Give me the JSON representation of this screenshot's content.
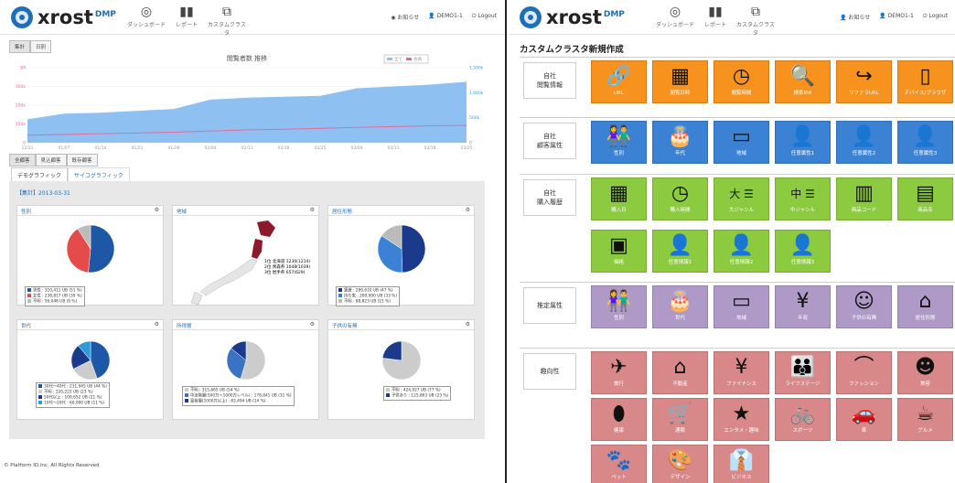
{
  "brand": {
    "name": "xrost",
    "suffix": "DMP"
  },
  "left": {
    "nav": [
      {
        "label": "ダッシュボード",
        "icon": "dashboard-icon",
        "glyph": "◎"
      },
      {
        "label": "レポート",
        "icon": "report-icon",
        "glyph": "▮▮"
      },
      {
        "label": "カスタムクラスタ",
        "icon": "cluster-icon",
        "glyph": "⧉"
      }
    ],
    "util": {
      "notice": "お知らせ",
      "user": "DEMO1-1",
      "logout": "Logout"
    },
    "toggle": [
      "集計",
      "日別"
    ],
    "chart_data": {
      "type": "area",
      "title": "閲覧者数 推移",
      "legend": [
        "全て",
        "会員"
      ],
      "x": [
        "12/31",
        "01/07",
        "01/14",
        "01/21",
        "01/28",
        "02/04",
        "02/11",
        "02/18",
        "02/25",
        "03/04",
        "03/11",
        "03/18",
        "03/25"
      ],
      "ylabels_left": [
        "3M",
        "300k",
        "200k",
        "150k",
        "0"
      ],
      "ylabels_right": [
        "1,500k",
        "1,000k",
        "500k",
        "0"
      ],
      "series": [
        {
          "name": "全て",
          "values": [
            125000,
            155000,
            160000,
            170000,
            180000,
            230000,
            240000,
            245000,
            250000,
            290000,
            300000,
            310000,
            325000
          ]
        },
        {
          "name": "会員",
          "values": [
            40000,
            44000,
            48000,
            52000,
            56000,
            62000,
            68000,
            72000,
            76000,
            82000,
            86000,
            90000,
            92000
          ]
        }
      ]
    },
    "visitor_tabs": [
      "全顧客",
      "見込顧客",
      "既存顧客"
    ],
    "profile_tabs": [
      "デモグラフィック",
      "サイコグラフィック"
    ],
    "aggregate": "【集計】2013-03-31",
    "cards": [
      {
        "title": "性別",
        "legend": [
          {
            "color": "#1e57a6",
            "text": "男性 : 310,411 UB (51 %)"
          },
          {
            "color": "#e64b4b",
            "text": "女性 : 238,817 UB (39 %)"
          },
          {
            "color": "#bbbbbb",
            "text": "不明 : 56,048 UB (9 %)"
          }
        ],
        "slices": [
          51,
          39,
          9
        ]
      },
      {
        "title": "地域",
        "ranks": [
          "1位 北海道 1230(1214)",
          "2位 青森県 1048(1039)",
          "3位 岩手県 657(629)"
        ]
      },
      {
        "title": "居住形態",
        "legend": [
          {
            "color": "#1c3a8c",
            "text": "賃貸 : 289,610 UB (47 %)"
          },
          {
            "color": "#3b82d4",
            "text": "持ち家 : 200,990 UB (33 %)"
          },
          {
            "color": "#bbbbbb",
            "text": "不明 : 88,823 UB (15 %)"
          }
        ],
        "slices": [
          47,
          33,
          15
        ]
      },
      {
        "title": "世代",
        "legend": [
          {
            "color": "#1e57a6",
            "text": "30代〜40代 : 231,945 UB (44 %)"
          },
          {
            "color": "#cccccc",
            "text": "不明 : 120,223 UB (23 %)"
          },
          {
            "color": "#1c3a8c",
            "text": "50代以上 : 109,652 UB (21 %)"
          },
          {
            "color": "#2e9bd4",
            "text": "10代〜20代 : 60,000 UB (11 %)"
          }
        ],
        "slices": [
          44,
          23,
          21,
          11
        ]
      },
      {
        "title": "所得層",
        "legend": [
          {
            "color": "#cccccc",
            "text": "不明 : 315,665 UB (54 %)"
          },
          {
            "color": "#3b72c4",
            "text": "中流階層(500万〜1000万レベル) : 178,841 UB (31 %)"
          },
          {
            "color": "#1c3a8c",
            "text": "富裕層(1000万以上) : 83,494 UB (14 %)"
          }
        ],
        "slices": [
          54,
          31,
          14
        ]
      },
      {
        "title": "子供の有無",
        "legend": [
          {
            "color": "#cccccc",
            "text": "不明 : 424,927 UB (77 %)"
          },
          {
            "color": "#1c3a8c",
            "text": "子供あり : 125,863 UB (23 %)"
          }
        ],
        "slices": [
          77,
          23
        ]
      }
    ],
    "copyright": "© Platform ID,inc. All Rights Reserved"
  },
  "right": {
    "title": "カスタムクラスタ新規作成",
    "groups": [
      {
        "label": "自社\n閲覧情報",
        "color": "or",
        "tiles": [
          {
            "label": "URL",
            "icon": "url-icon",
            "glyph": "🔗"
          },
          {
            "label": "閲覧日時",
            "icon": "calendar-icon",
            "glyph": "▦"
          },
          {
            "label": "閲覧時間",
            "icon": "clock-icon",
            "glyph": "◷"
          },
          {
            "label": "検索KW",
            "icon": "search-keyword-icon",
            "glyph": "🔍"
          },
          {
            "label": "リファラURL",
            "icon": "referrer-icon",
            "glyph": "↪"
          },
          {
            "label": "デバイス/ブラウザ",
            "icon": "device-icon",
            "glyph": "▯"
          }
        ]
      },
      {
        "label": "自社\n顧客属性",
        "color": "bl",
        "tiles": [
          {
            "label": "性別",
            "icon": "gender-icon",
            "glyph": "👫"
          },
          {
            "label": "年代",
            "icon": "age-cake-icon",
            "glyph": "🎂"
          },
          {
            "label": "地域",
            "icon": "region-icon",
            "glyph": "▭"
          },
          {
            "label": "任意属性1",
            "icon": "add-user-icon",
            "glyph": "👤"
          },
          {
            "label": "任意属性2",
            "icon": "add-user-icon",
            "glyph": "👤"
          },
          {
            "label": "任意属性3",
            "icon": "add-user-icon",
            "glyph": "👤"
          }
        ]
      },
      {
        "label": "自社\n購入履歴",
        "color": "gr",
        "tiles": [
          {
            "label": "購入日",
            "icon": "calendar-icon",
            "glyph": "▦"
          },
          {
            "label": "購入時間",
            "icon": "clock-icon",
            "glyph": "◷"
          },
          {
            "label": "大ジャンル",
            "icon": "large-genre-icon",
            "glyph": "大 ☰"
          },
          {
            "label": "中ジャンル",
            "icon": "middle-genre-icon",
            "glyph": "中 ☰"
          },
          {
            "label": "商品コード",
            "icon": "barcode-icon",
            "glyph": "▥"
          },
          {
            "label": "商品名",
            "icon": "product-name-icon",
            "glyph": "▤"
          },
          {
            "label": "価格",
            "icon": "register-icon",
            "glyph": "▣"
          },
          {
            "label": "任意情報1",
            "icon": "add-user-icon",
            "glyph": "👤"
          },
          {
            "label": "任意情報2",
            "icon": "add-user-icon",
            "glyph": "👤"
          },
          {
            "label": "任意情報3",
            "icon": "add-user-icon",
            "glyph": "👤"
          }
        ]
      },
      {
        "label": "推定属性",
        "color": "pu",
        "tiles": [
          {
            "label": "性別",
            "icon": "gender-icon",
            "glyph": "👫"
          },
          {
            "label": "世代",
            "icon": "age-cake-icon",
            "glyph": "🎂"
          },
          {
            "label": "地域",
            "icon": "region-icon",
            "glyph": "▭"
          },
          {
            "label": "年収",
            "icon": "yen-icon",
            "glyph": "¥"
          },
          {
            "label": "子供の有無",
            "icon": "child-icon",
            "glyph": "☺"
          },
          {
            "label": "居住形態",
            "icon": "house-icon",
            "glyph": "⌂"
          }
        ]
      },
      {
        "label": "趣向性",
        "color": "pk",
        "tiles": [
          {
            "label": "旅行",
            "icon": "travel-icon",
            "glyph": "✈"
          },
          {
            "label": "不動産",
            "icon": "real-estate-icon",
            "glyph": "⌂"
          },
          {
            "label": "ファイナンス",
            "icon": "yen-icon",
            "glyph": "¥"
          },
          {
            "label": "ライフステージ",
            "icon": "family-icon",
            "glyph": "👪"
          },
          {
            "label": "ファッション",
            "icon": "hanger-icon",
            "glyph": "⌒"
          },
          {
            "label": "美容",
            "icon": "beauty-icon",
            "glyph": "☻"
          },
          {
            "label": "健康",
            "icon": "pill-icon",
            "glyph": "⬮"
          },
          {
            "label": "通販",
            "icon": "cart-icon",
            "glyph": "🛒"
          },
          {
            "label": "エンタメ・趣味",
            "icon": "star-icon",
            "glyph": "★"
          },
          {
            "label": "スポーツ",
            "icon": "bicycle-icon",
            "glyph": "🚲"
          },
          {
            "label": "車",
            "icon": "car-icon",
            "glyph": "🚗"
          },
          {
            "label": "グルメ",
            "icon": "gourmet-icon",
            "glyph": "☕"
          },
          {
            "label": "ペット",
            "icon": "paw-icon",
            "glyph": "🐾"
          },
          {
            "label": "デザイン",
            "icon": "palette-icon",
            "glyph": "🎨"
          },
          {
            "label": "ビジネス",
            "icon": "business-icon",
            "glyph": "👔"
          }
        ]
      }
    ]
  }
}
